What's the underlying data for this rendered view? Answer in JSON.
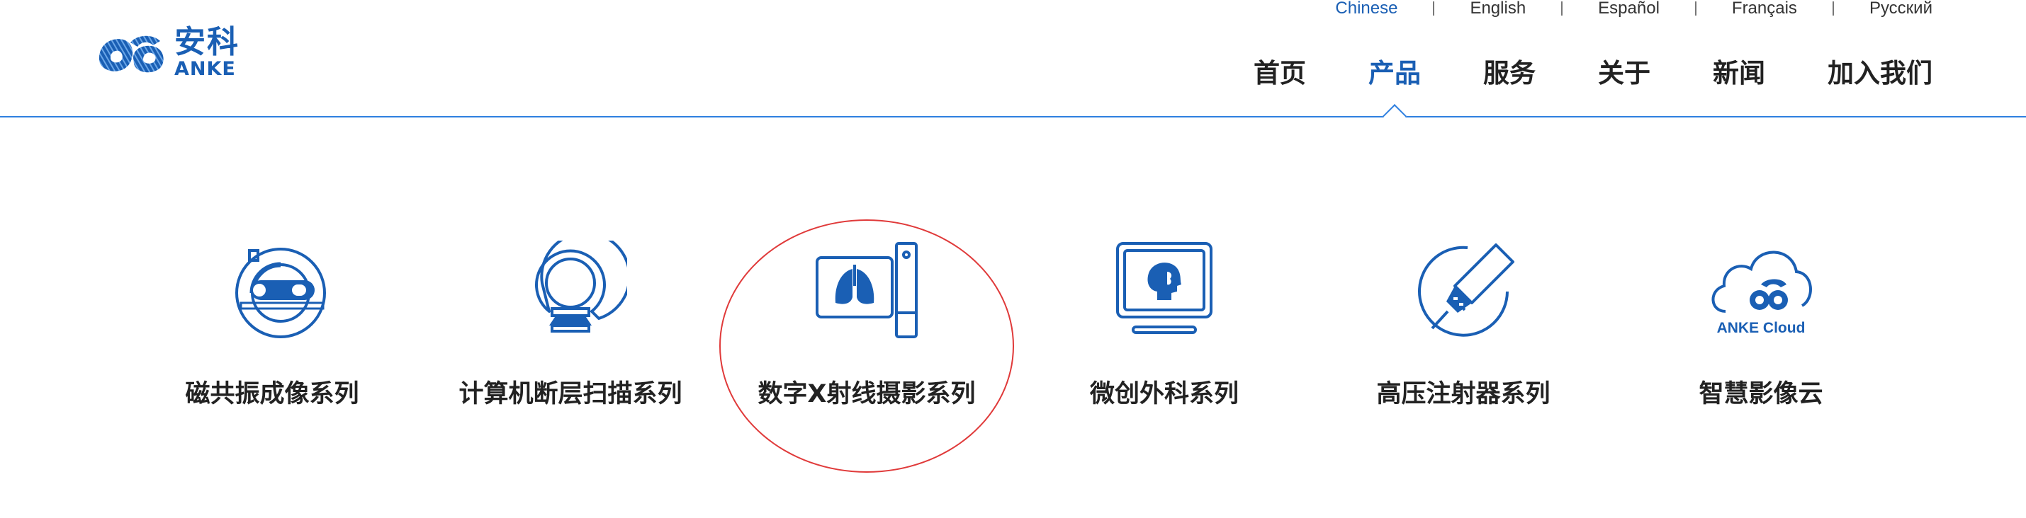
{
  "brand": {
    "name_cn": "安科",
    "name_en": "ANKE",
    "color": "#1a5fb4"
  },
  "languages": [
    {
      "label": "Chinese",
      "active": true
    },
    {
      "label": "English",
      "active": false
    },
    {
      "label": "Español",
      "active": false
    },
    {
      "label": "Français",
      "active": false
    },
    {
      "label": "Русский",
      "active": false
    }
  ],
  "nav": [
    {
      "label": "首页",
      "active": false
    },
    {
      "label": "产品",
      "active": true
    },
    {
      "label": "服务",
      "active": false
    },
    {
      "label": "关于",
      "active": false
    },
    {
      "label": "新闻",
      "active": false
    },
    {
      "label": "加入我们",
      "active": false
    }
  ],
  "products": [
    {
      "label": "磁共振成像系列",
      "icon": "mri-scanner-icon"
    },
    {
      "label": "计算机断层扫描系列",
      "icon": "ct-scanner-icon"
    },
    {
      "label": "数字X射线摄影系列",
      "icon": "xray-lungs-icon"
    },
    {
      "label": "微创外科系列",
      "icon": "surgery-monitor-icon"
    },
    {
      "label": "高压注射器系列",
      "icon": "injector-syringe-icon"
    },
    {
      "label": "智慧影像云",
      "icon": "cloud-icon",
      "icon_text": "ANKE Cloud"
    }
  ],
  "colors": {
    "accent": "#1a5fb4",
    "line": "#2f80e0",
    "highlight": "#e03a3a"
  }
}
